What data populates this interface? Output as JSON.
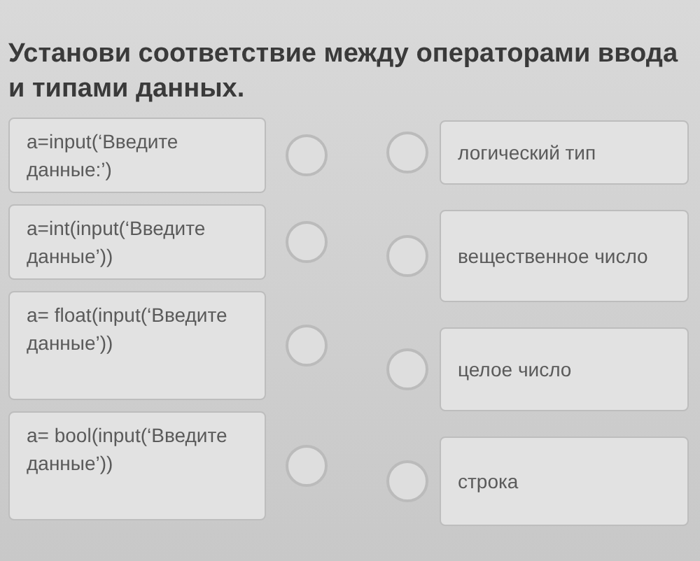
{
  "title": "Установи соответствие между операторами ввода и типами данных.",
  "left_items": [
    "a=input(‘Введите данные:’)",
    "a=int(input(‘Введите данные’))",
    "a= float(input(‘Введите данные’))",
    "a= bool(input(‘Введите данные’))"
  ],
  "right_items": [
    "логический тип",
    "вещественное число",
    "целое число",
    "строка"
  ]
}
